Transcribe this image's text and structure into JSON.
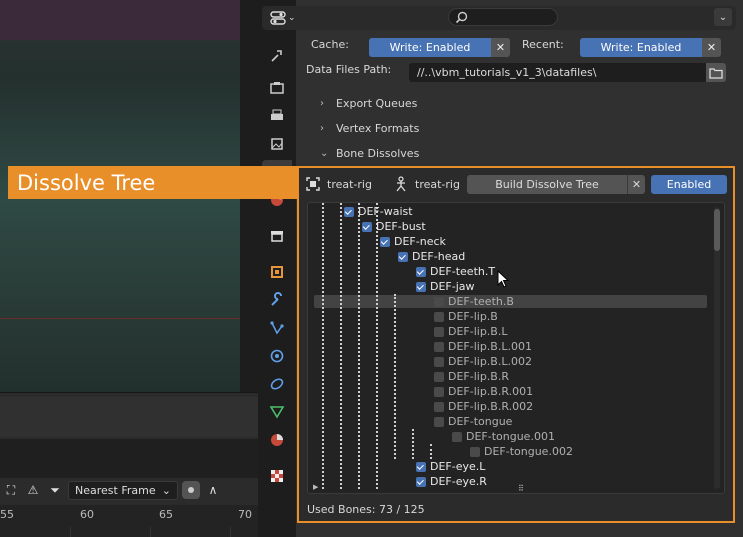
{
  "window": {
    "editor_type_icon": "properties-editor-icon",
    "search_placeholder": ""
  },
  "panel": {
    "cache_label": "Cache:",
    "cache_value": "Write: Enabled",
    "recent_label": "Recent:",
    "recent_value": "Write: Enabled",
    "data_path_label": "Data Files Path:",
    "data_path_value": "//..\\vbm_tutorials_v1_3\\datafiles\\",
    "sections": [
      "Export Queues",
      "Vertex Formats",
      "Bone Dissolves"
    ]
  },
  "callout": {
    "label": "Dissolve Tree"
  },
  "dissolve": {
    "armature_label": "treat-rig",
    "rig_label": "treat-rig",
    "build_label": "Build Dissolve Tree",
    "enabled_label": "Enabled",
    "used_bones": "Used Bones: 73 / 125",
    "bones": [
      {
        "name": "DEF-waist",
        "checked": true
      },
      {
        "name": "DEF-bust",
        "checked": true
      },
      {
        "name": "DEF-neck",
        "checked": true
      },
      {
        "name": "DEF-head",
        "checked": true
      },
      {
        "name": "DEF-teeth.T",
        "checked": true
      },
      {
        "name": "DEF-jaw",
        "checked": true
      },
      {
        "name": "DEF-teeth.B",
        "checked": false
      },
      {
        "name": "DEF-lip.B",
        "checked": false
      },
      {
        "name": "DEF-lip.B.L",
        "checked": false
      },
      {
        "name": "DEF-lip.B.L.001",
        "checked": false
      },
      {
        "name": "DEF-lip.B.L.002",
        "checked": false
      },
      {
        "name": "DEF-lip.B.R",
        "checked": false
      },
      {
        "name": "DEF-lip.B.R.001",
        "checked": false
      },
      {
        "name": "DEF-lip.B.R.002",
        "checked": false
      },
      {
        "name": "DEF-tongue",
        "checked": false
      },
      {
        "name": "DEF-tongue.001",
        "checked": false
      },
      {
        "name": "DEF-tongue.002",
        "checked": false
      },
      {
        "name": "DEF-eye.L",
        "checked": true
      },
      {
        "name": "DEF-eye.R",
        "checked": true
      }
    ]
  },
  "timeline": {
    "interpolation": "Nearest Frame",
    "ticks": [
      "55",
      "60",
      "65",
      "70"
    ]
  },
  "colors": {
    "accent": "#4772b3",
    "highlight": "#e88f2a"
  }
}
